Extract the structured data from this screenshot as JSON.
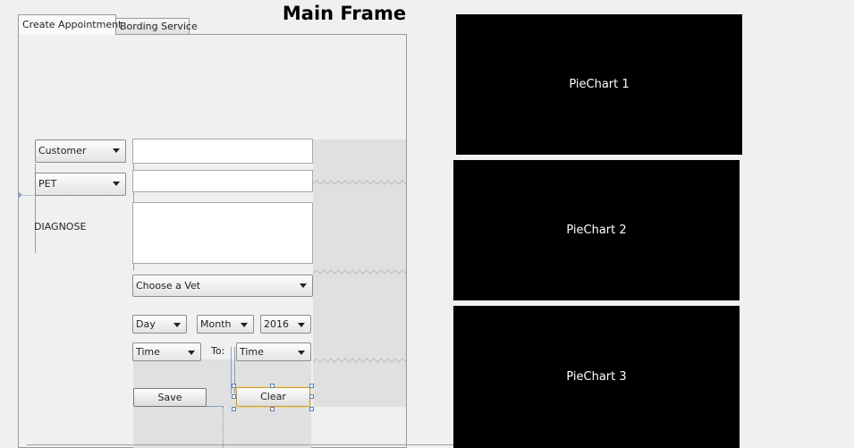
{
  "window": {
    "title": "Main Frame"
  },
  "tabs": [
    {
      "label": "Create Appointment",
      "active": true
    },
    {
      "label": "Bording Service",
      "active": false
    }
  ],
  "form": {
    "customer_combo": "Customer",
    "pet_combo": "PET",
    "diagnose_label": "DIAGNOSE",
    "vet_combo": "Choose a Vet",
    "day_combo": "Day",
    "month_combo": "Month",
    "year_combo": "2016",
    "time_from_combo": "Time",
    "to_label": "To:",
    "time_to_combo": "Time",
    "save_label": "Save",
    "clear_label": "Clear"
  },
  "charts": [
    {
      "label": "PieChart 1"
    },
    {
      "label": "PieChart 2"
    },
    {
      "label": "PieChart 3"
    }
  ],
  "colors": {
    "chart_background": "#000000",
    "chart_text": "#ffffff",
    "focus": "#c8a03c"
  },
  "icons": {
    "dropdown": "chevron-down-icon"
  }
}
